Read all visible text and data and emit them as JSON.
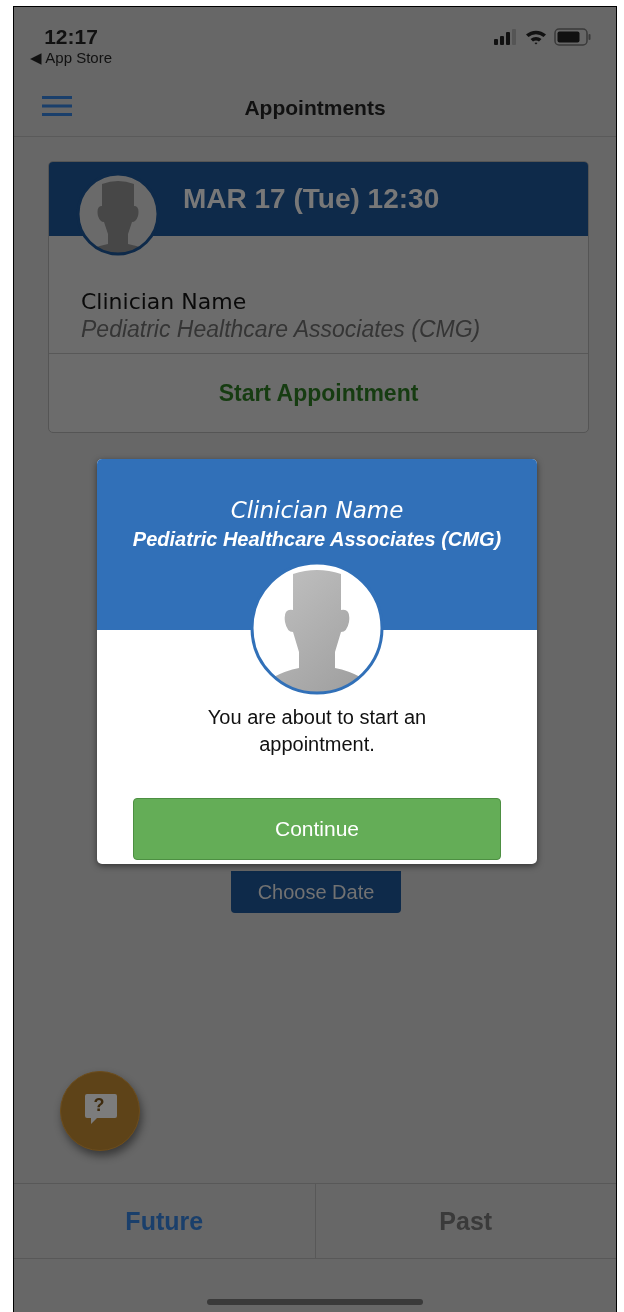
{
  "status_bar": {
    "time": "12:17",
    "back_label": "◀ App Store"
  },
  "header": {
    "title": "Appointments"
  },
  "appointment": {
    "date": "MAR 17 (Tue) 12:30",
    "clinician": "Clinician Name",
    "practice": "Pediatric Healthcare Associates (CMG)",
    "action": "Start Appointment"
  },
  "choose_date": {
    "label": "Choose Date"
  },
  "dialog": {
    "clinician": "Clinician Name",
    "practice": "Pediatric Healthcare Associates (CMG)",
    "message": "You are about to start an appointment.",
    "button": "Continue"
  },
  "help_button": {
    "symbol": "?"
  },
  "tabs": [
    {
      "label": "Future",
      "selected": true
    },
    {
      "label": "Past",
      "selected": false
    }
  ]
}
